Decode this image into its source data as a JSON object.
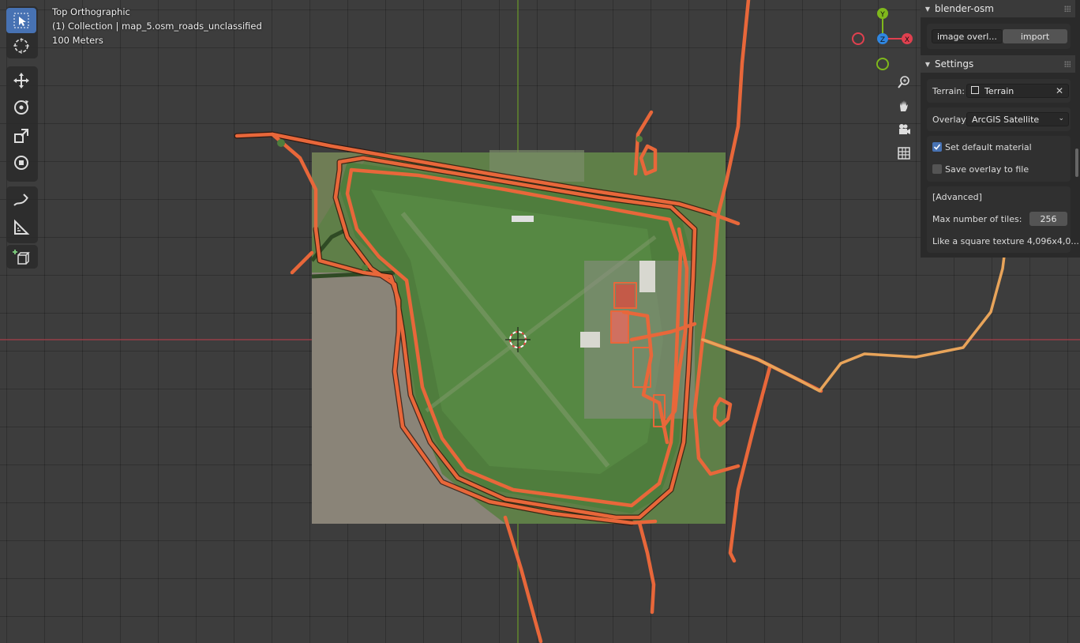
{
  "viewport": {
    "view_name": "Top Orthographic",
    "collection_line": "(1) Collection | map_5.osm_roads_unclassified",
    "scale_label": "100 Meters"
  },
  "gizmo": {
    "y_label": "Y",
    "z_label": "Z",
    "x_label": "X"
  },
  "toolbar": {
    "tools": [
      "select-box",
      "cursor",
      "move",
      "rotate",
      "scale",
      "transform",
      "annotate",
      "measure",
      "add-cube"
    ]
  },
  "sidebar": {
    "addon_panel": {
      "title": "blender-osm",
      "mode_dropdown": "image overl...",
      "import_button": "import"
    },
    "settings_panel": {
      "title": "Settings",
      "terrain_label": "Terrain:",
      "terrain_value": "Terrain",
      "overlay_label": "Overlay:",
      "overlay_value": "ArcGIS Satellite",
      "set_default_material": "Set default material",
      "save_overlay_to_file": "Save overlay to file",
      "advanced_label": "[Advanced]",
      "max_tiles_label": "Max number of tiles:",
      "max_tiles_value": "256",
      "texture_note": "Like a square texture 4,096x4,0..."
    }
  },
  "colors": {
    "road": "#e8673a",
    "road_dark": "#2a0d05",
    "grass": "#4d7a3a",
    "field": "#8a8478",
    "accent": "#4772b3",
    "x_axis": "#e0404f",
    "y_axis": "#7fb81c",
    "z_axis": "#2f86e0"
  }
}
